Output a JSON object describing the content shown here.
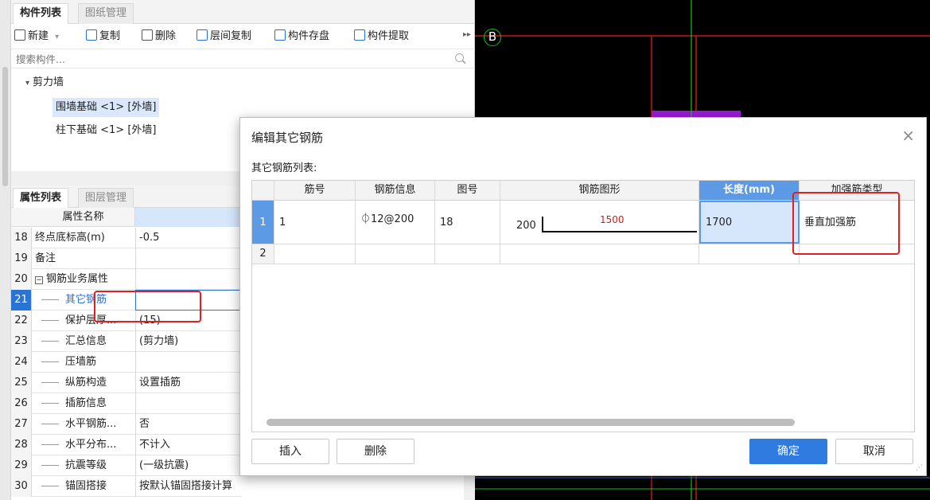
{
  "component_panel": {
    "tabs": [
      "构件列表",
      "图纸管理"
    ],
    "toolbar": {
      "new": "新建",
      "new_arrow": "▾",
      "copy": "复制",
      "delete": "删除",
      "floor_copy": "层间复制",
      "save": "构件存盘",
      "extract": "构件提取",
      "more": "▸▸"
    },
    "search_placeholder": "搜索构件...",
    "tree": {
      "group": "剪力墙",
      "group_arrow": "▾",
      "items": [
        "围墙基础 <1> [外墙]",
        "柱下基础 <1> [外墙]"
      ]
    }
  },
  "property_panel": {
    "tabs": [
      "属性列表",
      "图层管理"
    ],
    "header_name": "属性名称",
    "rows": [
      {
        "num": "18",
        "name": "终点底标高(m)",
        "value": "-0.5"
      },
      {
        "num": "19",
        "name": "备注",
        "value": ""
      },
      {
        "num": "20",
        "name": "钢筋业务属性",
        "value": "",
        "expander": "−"
      },
      {
        "num": "21",
        "name": "其它钢筋",
        "value": ""
      },
      {
        "num": "22",
        "name": "保护层厚...",
        "value": "(15)"
      },
      {
        "num": "23",
        "name": "汇总信息",
        "value": "(剪力墙)"
      },
      {
        "num": "24",
        "name": "压墙筋",
        "value": ""
      },
      {
        "num": "25",
        "name": "纵筋构造",
        "value": "设置插筋"
      },
      {
        "num": "26",
        "name": "插筋信息",
        "value": ""
      },
      {
        "num": "27",
        "name": "水平钢筋...",
        "value": "否"
      },
      {
        "num": "28",
        "name": "水平分布...",
        "value": "不计入"
      },
      {
        "num": "29",
        "name": "抗震等级",
        "value": "(一级抗震)"
      },
      {
        "num": "30",
        "name": "锚固搭接",
        "value": "按默认锚固搭接计算"
      }
    ]
  },
  "cad": {
    "axis_label": "B"
  },
  "dialog": {
    "title": "编辑其它钢筋",
    "close": "×",
    "subtitle": "其它钢筋列表:",
    "columns": [
      "筋号",
      "钢筋信息",
      "图号",
      "钢筋图形",
      "长度(mm)",
      "加强筋类型"
    ],
    "rows": [
      {
        "rn": "1",
        "bar_no": "1",
        "info": "⏀12@200",
        "fig_no": "18",
        "shape_left": "200",
        "shape_top": "1500",
        "length": "1700",
        "type": "垂直加强筋"
      },
      {
        "rn": "2",
        "bar_no": "",
        "info": "",
        "fig_no": "",
        "length": "",
        "type": ""
      }
    ],
    "buttons": {
      "insert": "插入",
      "delete": "删除",
      "ok": "确定",
      "cancel": "取消"
    }
  }
}
